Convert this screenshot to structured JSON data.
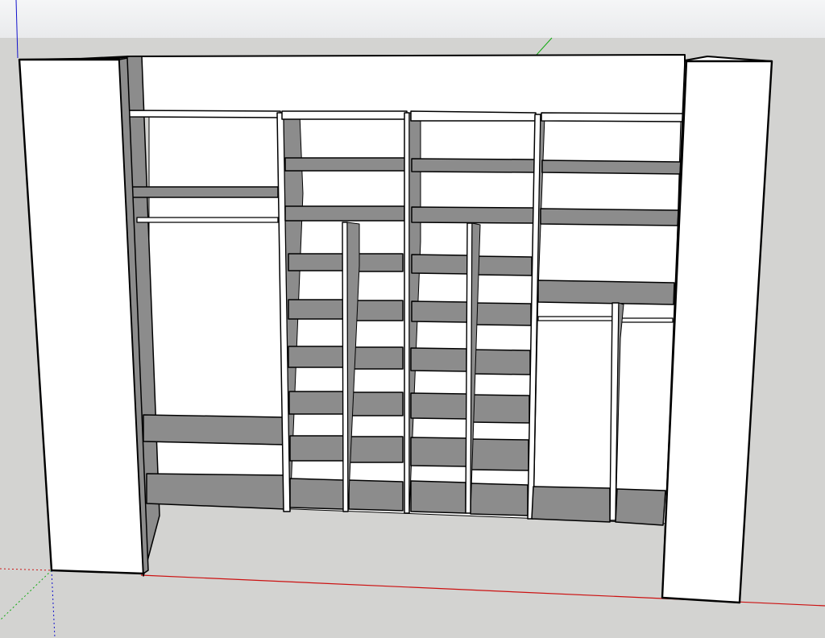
{
  "viewport": {
    "sky_color": "#eceded",
    "ground_color": "#d3d3d1",
    "axes": {
      "red_axis_color": "#cc1111",
      "green_axis_color": "#11aa11",
      "blue_axis_color": "#1111cc"
    }
  },
  "model": {
    "description_icon": "closet-shelving-3d-model",
    "face_colors": {
      "front_face": "#ffffff",
      "shaded_face": "#8c8c8c",
      "edge": "#000000"
    }
  }
}
